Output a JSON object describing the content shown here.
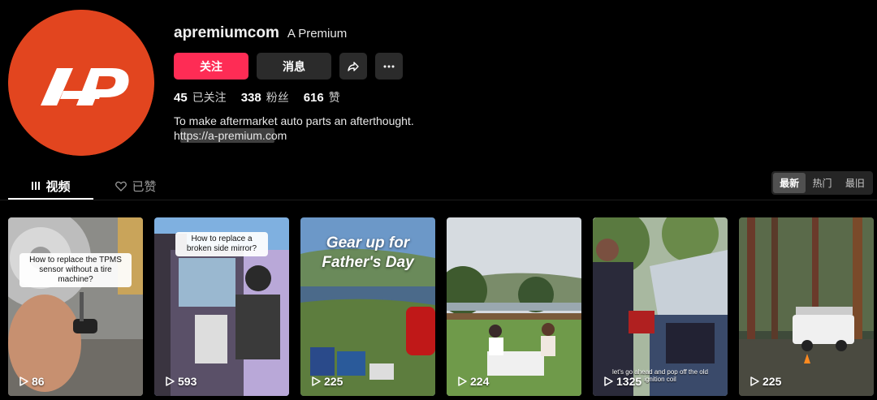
{
  "profile": {
    "handle": "apremiumcom",
    "display_name": "A Premium",
    "follow_label": "关注",
    "message_label": "消息",
    "stats": [
      {
        "num": "45",
        "label": "已关注"
      },
      {
        "num": "338",
        "label": "粉丝"
      },
      {
        "num": "616",
        "label": "赞"
      }
    ],
    "bio_line1": "To make aftermarket auto parts an afterthought.",
    "bio_link": "https://a-premium.com"
  },
  "colors": {
    "accent": "#fe2c55",
    "avatar_bg": "#e2451f"
  },
  "tabs": [
    {
      "label": "视频",
      "icon": "grid-icon",
      "active": true
    },
    {
      "label": "已赞",
      "icon": "heart-icon",
      "active": false
    }
  ],
  "sort": [
    {
      "label": "最新",
      "active": true
    },
    {
      "label": "热门",
      "active": false
    },
    {
      "label": "最旧",
      "active": false
    }
  ],
  "videos": [
    {
      "views": "86",
      "caption": "How to replace the TPMS sensor without a tire machine?"
    },
    {
      "views": "593",
      "caption": "How to replace a broken side mirror?"
    },
    {
      "views": "225",
      "caption": "Gear up for Father's Day"
    },
    {
      "views": "224",
      "caption": ""
    },
    {
      "views": "1325",
      "caption": "let's go ahead and pop off the old ignition coil"
    },
    {
      "views": "225",
      "caption": ""
    }
  ]
}
